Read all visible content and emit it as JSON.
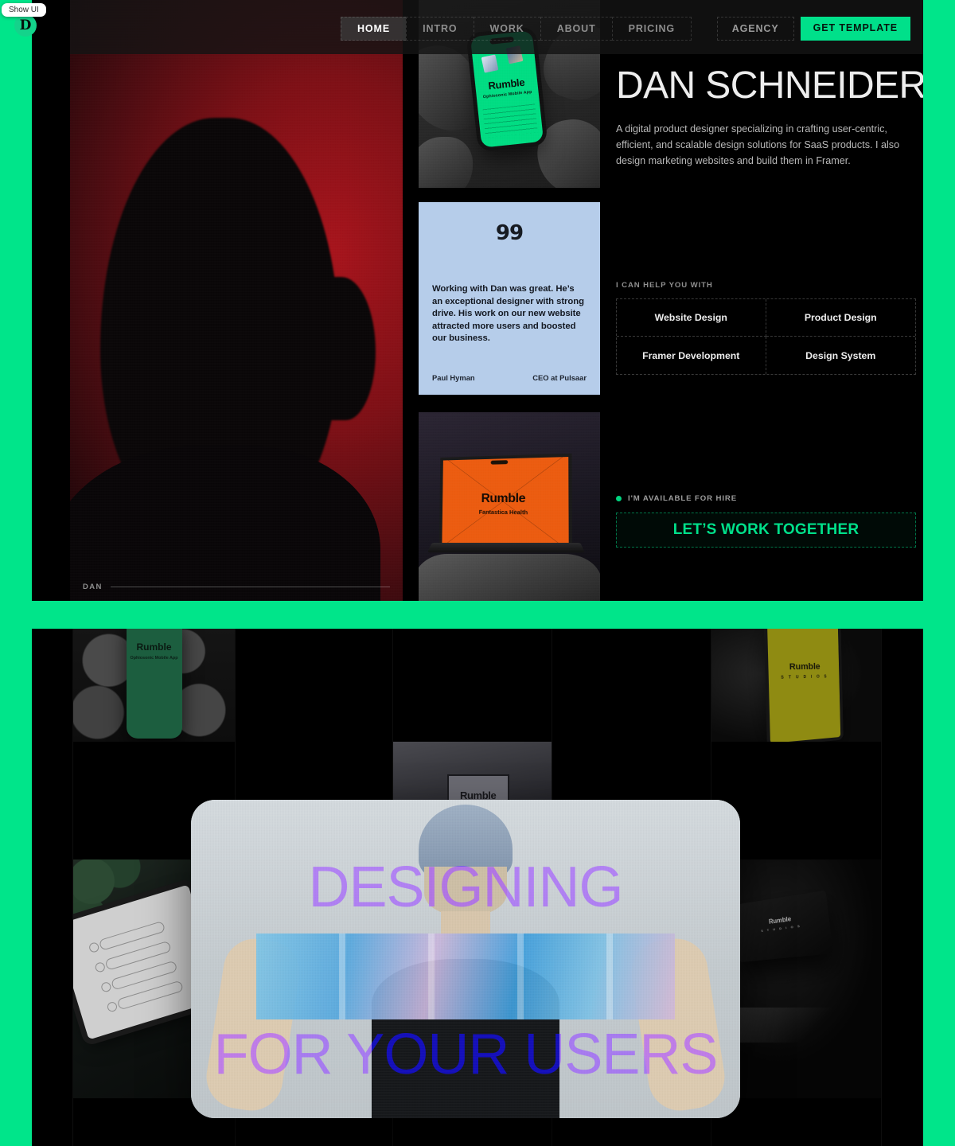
{
  "badge": {
    "show_ui_label": "Show UI",
    "logo_letter": "D"
  },
  "nav": {
    "items": [
      "HOME",
      "INTRO",
      "WORK",
      "ABOUT",
      "PRICING"
    ],
    "active": "HOME",
    "agency_label": "AGENCY",
    "template_label": "GET TEMPLATE"
  },
  "hero": {
    "title": "DAN SCHNEIDER",
    "description": "A digital product designer specializing in crafting user-centric, efficient, and scalable design solutions for SaaS products. I also design marketing websites and build them in Framer.",
    "portrait_label": "DAN",
    "help_label": "I CAN HELP YOU WITH",
    "skills": [
      "Website Design",
      "Product Design",
      "Framer Development",
      "Design System"
    ],
    "availability": "I'M AVAILABLE FOR HIRE",
    "cta_label": "LET’S WORK TOGETHER"
  },
  "testimonial": {
    "quote_mark": "99",
    "body": "Working with Dan was great. He’s an exceptional designer with strong drive. His work on our new website attracted more users and boosted our business.",
    "author": "Paul Hyman",
    "role": "CEO at Pulsaar"
  },
  "mockups": {
    "phone_rocks": {
      "brand": "Rumble",
      "subtitle": "Ophiosonic Mobile App"
    },
    "laptop_orange": {
      "brand": "Rumble",
      "subtitle": "Fantastica Health"
    },
    "phone_pebbles": {
      "brand": "Rumble",
      "subtitle": "Ophiosonic Mobile App"
    },
    "sign": {
      "brand": "Rumble"
    },
    "tablet_yellow": {
      "brand": "Rumble",
      "subtitle": "S T U D I O S"
    },
    "box_dark": {
      "brand": "Rumble",
      "subtitle": "S T U D I O S"
    }
  },
  "overlay": {
    "line1": "DESIGNING",
    "line2": "FOR YOUR USERS"
  },
  "colors": {
    "accent_green": "#00e08a",
    "page_green": "#00e58a",
    "quote_card": "#b6cdea",
    "orange": "#ec5c10",
    "yellow": "#8f8b12",
    "purple_text": "#6f4fd8"
  }
}
